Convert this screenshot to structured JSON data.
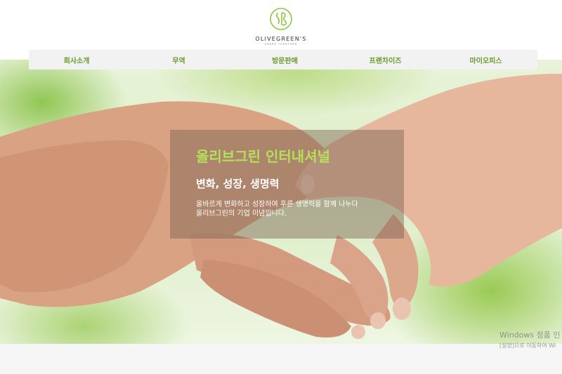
{
  "logo": {
    "name": "OLIVEGREEN'S",
    "tagline": "SHARE TOGETHER",
    "mark_color": "#8cc63f"
  },
  "nav": {
    "items": [
      {
        "label": "회사소개"
      },
      {
        "label": "무역"
      },
      {
        "label": "방문판매"
      },
      {
        "label": "프랜차이즈"
      },
      {
        "label": "마이오피스"
      }
    ]
  },
  "hero": {
    "title": "올리브그린 인터내셔널",
    "subtitle": "변화, 성장, 생명력",
    "description_line1": "올바르게 변화하고 성장하여 푸른 생명력을 함께 나누다",
    "description_line2": "올리브그린의 기업 이념입니다.",
    "accent_color": "#b5e05a"
  },
  "watermark": {
    "line1": "Windows 정품 인",
    "line2": "[설정]으로 이동하여 Wi"
  }
}
